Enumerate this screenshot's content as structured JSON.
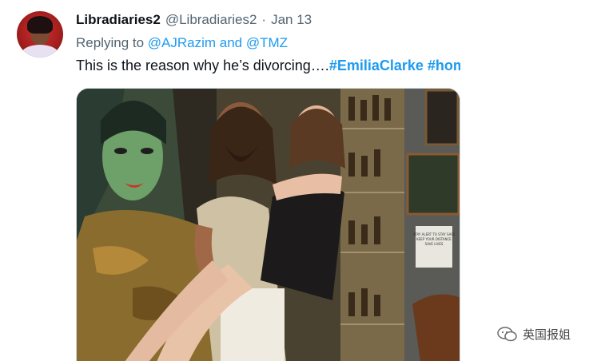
{
  "tweet": {
    "display_name": "Libradiaries2",
    "handle": "@Libradiaries2",
    "separator": "·",
    "date": "Jan 13",
    "more_label": "•••",
    "reply": {
      "prefix": "Replying to ",
      "mention1": "@AJRazim",
      "joiner": " and ",
      "mention2": "@TMZ"
    },
    "text": "This is the reason why he’s divorcing….",
    "hashtag1": "#EmiliaClarke",
    "hashtag2": "#homewrecker",
    "photo_sign": {
      "line1": "STAY ALERT TO STAY SAFE",
      "line2": "KEEP YOUR DISTANCE",
      "line3": "SAVE LIVES"
    }
  },
  "watermark": {
    "text": "英国报姐"
  },
  "colors": {
    "link": "#1d9bf0",
    "secondary": "#536471",
    "primary": "#0f1419"
  }
}
